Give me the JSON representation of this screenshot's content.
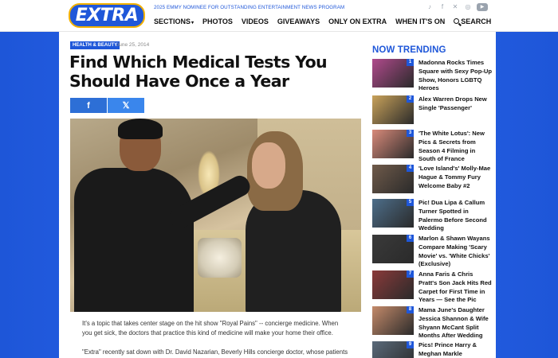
{
  "header": {
    "logo_text": "EXTRA",
    "tagline": "2025 EMMY NOMINEE FOR OUTSTANDING ENTERTAINMENT NEWS PROGRAM",
    "nav": [
      {
        "label": "SECTIONS",
        "has_dropdown": true
      },
      {
        "label": "PHOTOS"
      },
      {
        "label": "VIDEOS"
      },
      {
        "label": "GIVEAWAYS"
      },
      {
        "label": "ONLY ON EXTRA"
      },
      {
        "label": "WHEN IT'S ON"
      }
    ],
    "search_label": "SEARCH",
    "social_icons": [
      "tiktok-icon",
      "facebook-icon",
      "x-icon",
      "instagram-icon",
      "youtube-icon"
    ]
  },
  "article": {
    "category": "HEALTH & BEAUTY",
    "date": "June 25, 2014",
    "title": "Find Which Medical Tests You Should Have Once a Year",
    "share": {
      "facebook": "f",
      "x": "𝕏"
    },
    "paragraph1": "It's a topic that takes center stage on the hit show \"Royal Pains\" -- concierge medicine. When you get sick, the doctors that practice this kind of medicine will make your home their office.",
    "paragraph2": "\"Extra\" recently sat down with Dr. David Nazarian, Beverly Hills concierge doctor, whose patients"
  },
  "trending": {
    "title": "NOW TRENDING",
    "items": [
      {
        "num": "1",
        "text": "Madonna Rocks Times Square with Sexy Pop-Up Show, Honors LGBTQ Heroes",
        "thumb": "#b04a8c"
      },
      {
        "num": "2",
        "text": "Alex Warren Drops New Single 'Passenger'",
        "thumb": "#c9a25a"
      },
      {
        "num": "3",
        "text": "'The White Lotus': New Pics & Secrets from Season 4 Filming in South of France",
        "thumb": "#d98a7a"
      },
      {
        "num": "4",
        "text": "'Love Island's' Molly-Mae Hague & Tommy Fury Welcome Baby #2",
        "thumb": "#6f5a4a"
      },
      {
        "num": "5",
        "text": "Pic! Dua Lipa & Callum Turner Spotted in Palermo Before Second Wedding",
        "thumb": "#4d6e8a"
      },
      {
        "num": "6",
        "text": "Marlon & Shawn Wayans Compare Making 'Scary Movie' vs. 'White Chicks' (Exclusive)",
        "thumb": "#3a3a3a"
      },
      {
        "num": "7",
        "text": "Anna Faris & Chris Pratt's Son Jack Hits Red Carpet for First Time in Years — See the Pic",
        "thumb": "#8a3a3a"
      },
      {
        "num": "8",
        "text": "Mama June's Daughter Jessica Shannon & Wife Shyann McCant Split Months After Wedding",
        "thumb": "#c48a6a"
      },
      {
        "num": "9",
        "text": "Pics! Prince Harry & Meghan Markle",
        "thumb": "#5a6a7a"
      }
    ]
  },
  "colors": {
    "brand_blue": "#1f57d9",
    "accent_gold": "#f3b100"
  }
}
